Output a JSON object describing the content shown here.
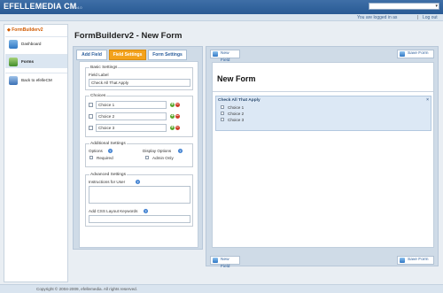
{
  "app": {
    "logo": "EFELLEMEDIA CM",
    "version": "v4.0",
    "top_select_value": ""
  },
  "userbar": {
    "logged_in": "You are logged in as",
    "separator": "|",
    "logout": "Log out"
  },
  "sidebar": {
    "title": "FormBuilderv2",
    "items": [
      {
        "label": "Dashboard",
        "icon": "dashboard-icon"
      },
      {
        "label": "Forms",
        "icon": "forms-icon"
      },
      {
        "label": "Back to efelleCM",
        "icon": "back-icon"
      }
    ]
  },
  "page": {
    "title": "FormBuilderv2 - New Form"
  },
  "tabs": [
    {
      "label": "Add Field"
    },
    {
      "label": "Field Settings"
    },
    {
      "label": "Form Settings"
    }
  ],
  "basic_settings": {
    "legend": "Basic Settings",
    "field_label_caption": "Field Label",
    "field_label_value": "Check All That Apply"
  },
  "choices": {
    "legend": "Choices",
    "items": [
      {
        "value": "Choice 1"
      },
      {
        "value": "Choice 2"
      },
      {
        "value": "Choice 3"
      }
    ]
  },
  "additional_settings": {
    "legend": "Additional Settings",
    "options_label": "Options",
    "required_label": "Required",
    "display_label": "Display Options",
    "admin_only_label": "Admin Only"
  },
  "advanced_settings": {
    "legend": "Advanced Settings",
    "instructions_label": "Instructions for User",
    "css_label": "Add CSS Layout Keywords"
  },
  "right": {
    "new_field": "New Field",
    "save_form": "Save Form",
    "form_title": "New Form",
    "field_preview_label": "Check All That Apply",
    "preview_choices": [
      "Choice 1",
      "Choice 2",
      "Choice 3"
    ]
  },
  "footer": {
    "copyright": "Copyright © 2004-2009, efellemedia. All rights reserved."
  },
  "colors": {
    "header": "#285a94",
    "accent_tab": "#f3a21c",
    "sidebar_title": "#d05a00"
  }
}
